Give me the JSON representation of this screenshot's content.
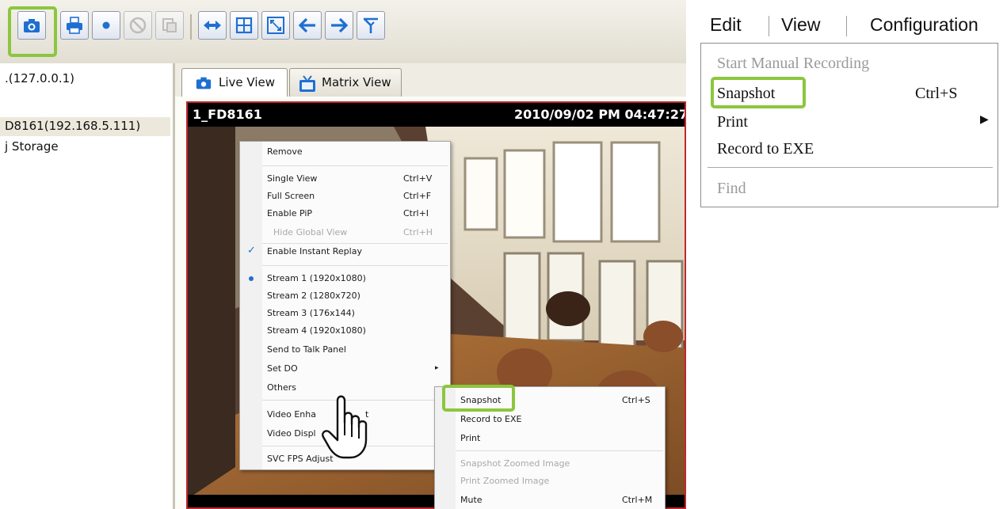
{
  "app": {
    "tree": {
      "items": [
        ".(127.0.0.1)",
        "D8161(192.168.5.111)",
        "j Storage"
      ]
    },
    "tabs": [
      {
        "label": "Live View",
        "icon": "camera-icon"
      },
      {
        "label": "Matrix View",
        "icon": "tv-icon"
      }
    ],
    "video": {
      "camera_name": "1_FD8161",
      "timestamp": "2010/09/02 PM 04:47:27"
    },
    "context_menu": {
      "items": [
        {
          "label": "Remove",
          "shortcut": ""
        },
        {
          "label": "Single View",
          "shortcut": "Ctrl+V"
        },
        {
          "label": "Full Screen",
          "shortcut": "Ctrl+F"
        },
        {
          "label": "Enable PiP",
          "shortcut": "Ctrl+I"
        },
        {
          "label": "Hide Global View",
          "shortcut": "Ctrl+H"
        },
        {
          "label": "Enable Instant Replay",
          "shortcut": ""
        },
        {
          "label": "Stream 1 (1920x1080)",
          "shortcut": ""
        },
        {
          "label": "Stream 2 (1280x720)",
          "shortcut": ""
        },
        {
          "label": "Stream 3 (176x144)",
          "shortcut": ""
        },
        {
          "label": "Stream 4 (1920x1080)",
          "shortcut": ""
        },
        {
          "label": "Send to Talk Panel",
          "shortcut": ""
        },
        {
          "label": "Set DO",
          "shortcut": ""
        },
        {
          "label": "Others",
          "shortcut": ""
        },
        {
          "label": "Video Enha",
          "shortcut": ""
        },
        {
          "label": "Video Displ",
          "shortcut": ""
        },
        {
          "label": "SVC FPS Adjust",
          "shortcut": ""
        }
      ],
      "cursor_fragment": "t"
    },
    "submenu": {
      "items": [
        {
          "label": "Snapshot",
          "shortcut": "Ctrl+S"
        },
        {
          "label": "Record to EXE",
          "shortcut": ""
        },
        {
          "label": "Print",
          "shortcut": ""
        },
        {
          "label": "Snapshot Zoomed Image",
          "shortcut": ""
        },
        {
          "label": "Print Zoomed Image",
          "shortcut": ""
        },
        {
          "label": "Mute",
          "shortcut": "Ctrl+M"
        }
      ]
    }
  },
  "menu_panel": {
    "menubar": [
      "Edit",
      "View",
      "Configuration"
    ],
    "dropdown": [
      {
        "label": "Start Manual Recording",
        "shortcut": ""
      },
      {
        "label": "Snapshot",
        "shortcut": "Ctrl+S"
      },
      {
        "label": "Print",
        "shortcut": ""
      },
      {
        "label": "Record to EXE",
        "shortcut": ""
      },
      {
        "label": "Find",
        "shortcut": ""
      }
    ]
  },
  "colors": {
    "highlight": "#8cc63f",
    "toolbar_icon": "#1f6fd1",
    "video_border": "#c0272d"
  }
}
